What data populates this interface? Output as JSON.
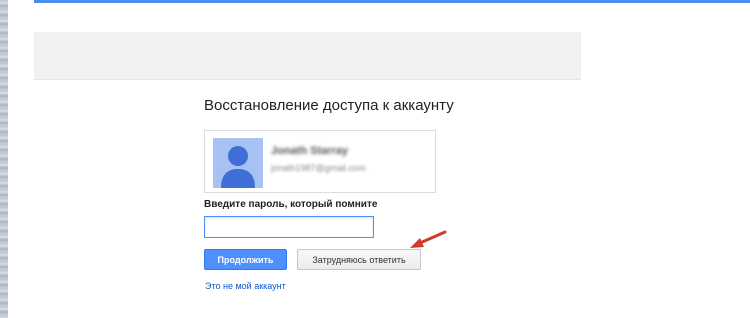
{
  "header": {
    "accent_color": "#4a8ef0"
  },
  "recovery": {
    "title": "Восстановление доступа к аккаунту",
    "account": {
      "name": "Jonath Starray",
      "email": "jonath1987@gmail.com",
      "avatar_icon": "person-silhouette-icon",
      "avatar_color": "#a7c2f2"
    },
    "password_label": "Введите пароль, который помните",
    "password_value": "",
    "continue_label": "Продолжить",
    "unsure_label": "Затрудняюсь ответить",
    "not_my_account_label": "Это не мой аккаунт",
    "primary_color": "#4d90fe",
    "link_color": "#1155cc",
    "annotation": {
      "icon": "red-arrow-icon",
      "color": "#d23a2b"
    }
  }
}
